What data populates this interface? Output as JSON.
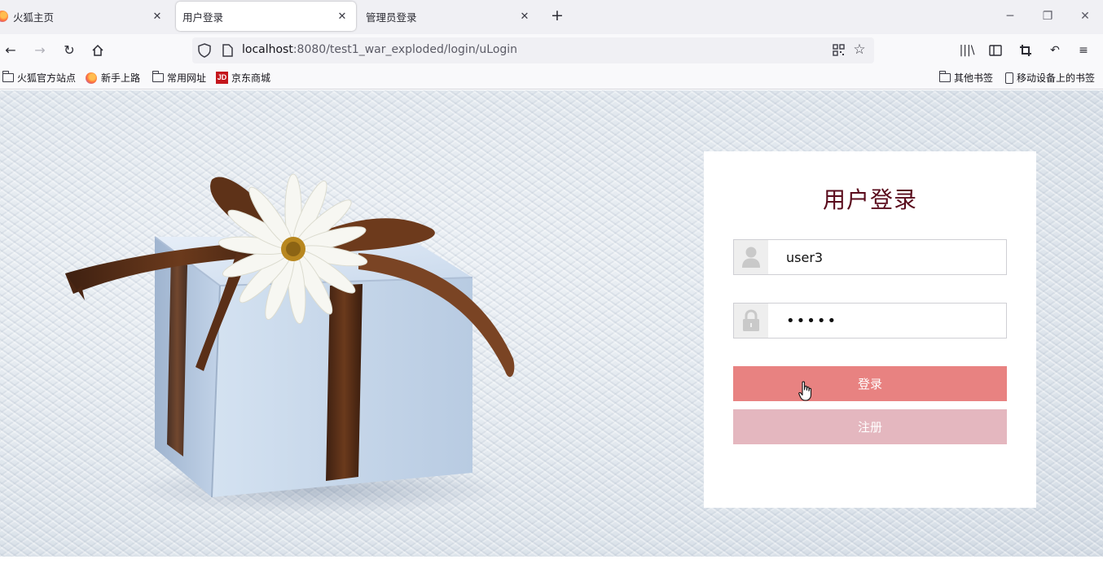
{
  "browser": {
    "tabs": [
      {
        "label": "火狐主页",
        "active": false
      },
      {
        "label": "用户登录",
        "active": true
      },
      {
        "label": "管理员登录",
        "active": false
      }
    ],
    "url": {
      "host": "localhost",
      "rest": ":8080/test1_war_exploded/login/uLogin"
    },
    "bookmarks": [
      {
        "label": "火狐官方站点",
        "icon": "folder-icon"
      },
      {
        "label": "新手上路",
        "icon": "firefox-icon"
      },
      {
        "label": "常用网址",
        "icon": "folder-icon"
      },
      {
        "label": "京东商城",
        "icon": "jd-icon"
      }
    ],
    "other_bookmarks": "其他书签",
    "mobile_bookmarks": "移动设备上的书签",
    "jd_badge": "JD"
  },
  "login": {
    "title": "用户登录",
    "username_value": "user3",
    "password_value": "•••••",
    "login_label": "登录",
    "register_label": "注册",
    "colors": {
      "title": "#5a0b1c",
      "login_button": "#e88281",
      "register_button": "#e4b7bf"
    }
  }
}
